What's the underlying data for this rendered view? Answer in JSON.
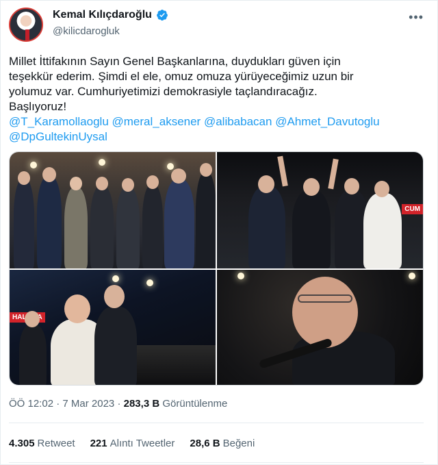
{
  "author": {
    "display_name": "Kemal Kılıçdaroğlu",
    "handle": "@kilicdarogluk",
    "verified": true,
    "avatar_icon": "profile-photo",
    "verified_icon": "verified-badge-icon",
    "accent_color": "#1d9bf0"
  },
  "more_icon": "more-options-icon",
  "tweet": {
    "lines": [
      "Millet İttifakının Sayın Genel Başkanlarına, duydukları güven için",
      "teşekkür ederim. Şimdi el ele, omuz omuza yürüyeceğimiz uzun bir",
      "yolumuz var. Cumhuriyetimizi demokrasiyle taçlandıracağız.",
      "Başlıyoruz!"
    ],
    "mentions": [
      "@T_Karamollaoglu",
      "@meral_aksener",
      "@alibabacan",
      "@Ahmet_Davutoglu",
      "@DpGultekinUysal"
    ]
  },
  "media": {
    "photos": [
      {
        "banner": ""
      },
      {
        "banner": "CUM"
      },
      {
        "banner": "HALK PA"
      },
      {
        "banner": ""
      }
    ]
  },
  "meta": {
    "time": "ÖÖ 12:02",
    "separator": "·",
    "date": "7 Mar 2023",
    "views_count": "283,3 B",
    "views_label": "Görüntülenme"
  },
  "stats": {
    "retweets_count": "4.305",
    "retweets_label": "Retweet",
    "quotes_count": "221",
    "quotes_label": "Alıntı Tweetler",
    "likes_count": "28,6 B",
    "likes_label": "Beğeni"
  }
}
